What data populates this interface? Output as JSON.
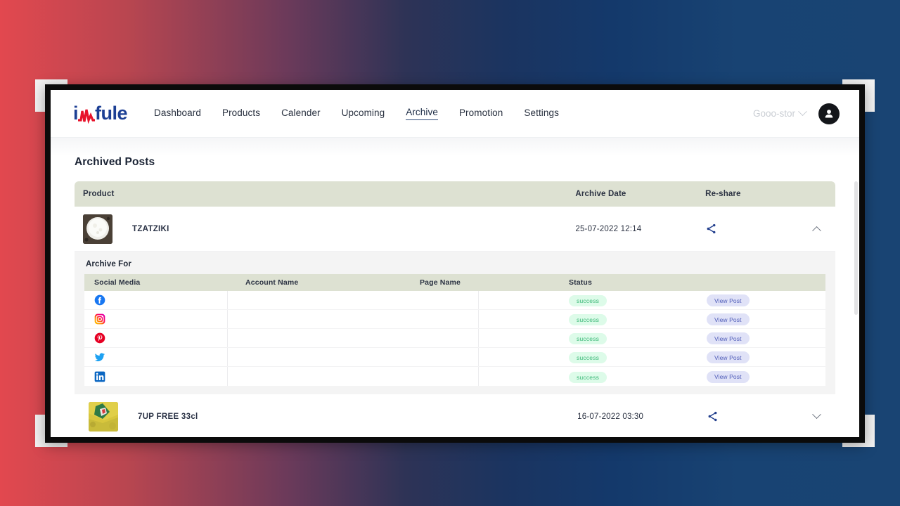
{
  "brand": {
    "logo_text_left": "i",
    "logo_icon": "pulse-zigzag-icon",
    "logo_text_right": "fule",
    "logo_color": "#1c3f94",
    "logo_accent_color": "#e8132b"
  },
  "nav": {
    "links": [
      {
        "label": "Dashboard",
        "active": false
      },
      {
        "label": "Products",
        "active": false
      },
      {
        "label": "Calender",
        "active": false
      },
      {
        "label": "Upcoming",
        "active": false
      },
      {
        "label": "Archive",
        "active": true
      },
      {
        "label": "Promotion",
        "active": false
      },
      {
        "label": "Settings",
        "active": false
      }
    ],
    "store_selector": "Gooo-stor",
    "store_selector_icon": "chevron-down-icon",
    "account_icon": "user-avatar-icon"
  },
  "page": {
    "title": "Archived Posts"
  },
  "table": {
    "headers": {
      "product": "Product",
      "archive_date": "Archive Date",
      "reshare": "Re-share"
    },
    "rows": [
      {
        "name": "TZATZIKI",
        "thumbnail": "tzatziki-bowl-thumbnail",
        "date": "25-07-2022 12:14",
        "share_icon": "share-icon",
        "toggle_icon": "chevron-up-icon",
        "expanded": true
      },
      {
        "name": "7UP FREE 33cl",
        "thumbnail": "7up-can-thumbnail",
        "date": "16-07-2022 03:30",
        "share_icon": "share-icon",
        "toggle_icon": "chevron-down-icon",
        "expanded": false
      }
    ]
  },
  "archive_for": {
    "title": "Archive For",
    "headers": {
      "social_media": "Social Media",
      "account_name": "Account Name",
      "page_name": "Page Name",
      "status": "Status"
    },
    "rows": [
      {
        "network": "facebook-icon",
        "account_name": "",
        "page_name": "",
        "status": "success",
        "action": "View Post"
      },
      {
        "network": "instagram-icon",
        "account_name": "",
        "page_name": "",
        "status": "success",
        "action": "View Post"
      },
      {
        "network": "pinterest-icon",
        "account_name": "",
        "page_name": "",
        "status": "success",
        "action": "View Post"
      },
      {
        "network": "twitter-icon",
        "account_name": "",
        "page_name": "",
        "status": "success",
        "action": "View Post"
      },
      {
        "network": "linkedin-icon",
        "account_name": "",
        "page_name": "",
        "status": "success",
        "action": "View Post"
      }
    ]
  },
  "colors": {
    "table_header_bg": "#dde1d2",
    "badge_success_bg": "#ddfbe9",
    "badge_success_text": "#3cb878",
    "view_post_bg": "#e0e2f7",
    "view_post_text": "#4e5bb8",
    "share_icon": "#24408e",
    "background_gradient_start": "#e2484f",
    "background_gradient_end": "#194473"
  }
}
